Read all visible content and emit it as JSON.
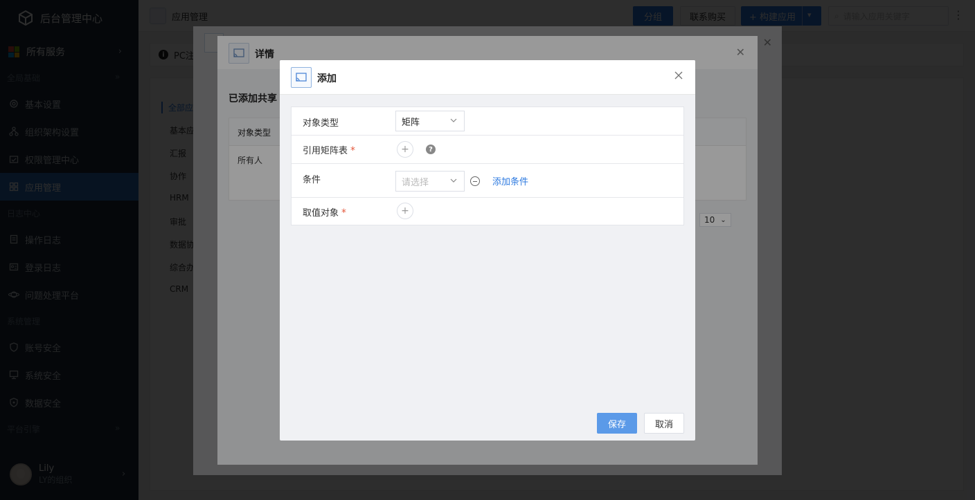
{
  "app": {
    "title": "后台管理中心"
  },
  "sidebar": {
    "all_services": "所有服务",
    "groups": [
      {
        "label": "全局基础"
      },
      {
        "label": "日志中心"
      },
      {
        "label": "系统管理"
      },
      {
        "label": "平台引擎"
      }
    ],
    "items": [
      {
        "label": "基本设置",
        "icon": "gear-icon"
      },
      {
        "label": "组织架构设置",
        "icon": "org-icon"
      },
      {
        "label": "权限管理中心",
        "icon": "permission-icon"
      },
      {
        "label": "应用管理",
        "icon": "app-grid-icon",
        "active": true
      },
      {
        "label": "操作日志",
        "icon": "log-icon"
      },
      {
        "label": "登录日志",
        "icon": "login-log-icon"
      },
      {
        "label": "问题处理平台",
        "icon": "planet-icon"
      },
      {
        "label": "账号安全",
        "icon": "shield-icon"
      },
      {
        "label": "系统安全",
        "icon": "monitor-icon"
      },
      {
        "label": "数据安全",
        "icon": "data-shield-icon"
      }
    ],
    "user": {
      "name": "Lily",
      "org": "LY的组织"
    }
  },
  "topbar": {
    "title": "应用管理",
    "btn_group": "分组",
    "btn_buy": "联系购买",
    "btn_build": "+ 构建应用",
    "search_placeholder": "请输入应用关键字"
  },
  "background": {
    "notice": "PC注",
    "categories": [
      "全部应",
      "基本应",
      "汇报",
      "协作",
      "HRM",
      "审批",
      "数据协",
      "综合办",
      "CRM"
    ]
  },
  "detail_modal": {
    "title": "详情",
    "section_label": "已添加共享",
    "table_header": "对象类型",
    "table_row": "所有人",
    "page_size": "10"
  },
  "dialog": {
    "title": "添加",
    "fields": {
      "object_type": {
        "label": "对象类型",
        "value": "矩阵"
      },
      "matrix_table": {
        "label": "引用矩阵表"
      },
      "condition": {
        "label": "条件",
        "placeholder": "请选择",
        "add_label": "添加条件"
      },
      "value_object": {
        "label": "取值对象"
      }
    },
    "required_mark": "*",
    "save": "保存",
    "cancel": "取消"
  },
  "colors": {
    "primary": "#2d7ae0",
    "sidebar_bg": "#1f2d3d",
    "required": "#e4593d"
  }
}
